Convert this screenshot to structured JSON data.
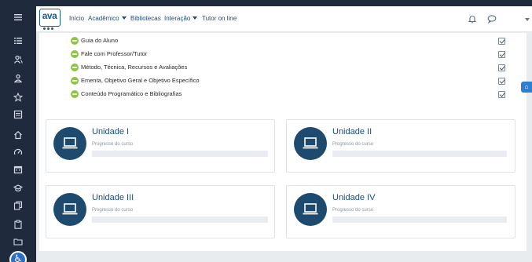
{
  "navbar": {
    "logo_text": "ava",
    "items": [
      {
        "label": "Início",
        "has_dropdown": false
      },
      {
        "label": "Acadêmico",
        "has_dropdown": true
      },
      {
        "label": "Bibliotecas",
        "has_dropdown": false
      },
      {
        "label": "Interação",
        "has_dropdown": true
      },
      {
        "label": "Tutor on line",
        "has_dropdown": false
      }
    ],
    "icons": [
      "notification-bell-icon",
      "messages-chat-icon",
      "user-menu-caret-icon"
    ]
  },
  "sidebar": {
    "icons": [
      "menu-toggle-icon",
      "list-icon",
      "users-icon",
      "group-icon",
      "star-icon",
      "courses-icon",
      "home-icon",
      "dashboard-icon",
      "calendar-icon",
      "graduation-icon",
      "files-icon",
      "clipboard-icon",
      "folder-icon",
      "accessibility-icon"
    ]
  },
  "activities": [
    {
      "label": "Guia do Aluno",
      "completed": true
    },
    {
      "label": "Fale com Professor/Tutor",
      "completed": true
    },
    {
      "label": "Método, Técnica, Recursos e Avaliações",
      "completed": true
    },
    {
      "label": "Ementa, Objetivo Geral e Objetivo Específico",
      "completed": true
    },
    {
      "label": "Conteúdo Programático e Bibliografias",
      "completed": true
    }
  ],
  "units": [
    {
      "title": "Unidade I",
      "progress_label": "Progresso do curso",
      "progress": 0
    },
    {
      "title": "Unidade II",
      "progress_label": "Progresso do curso",
      "progress": 0
    },
    {
      "title": "Unidade III",
      "progress_label": "Progresso do curso",
      "progress": 0
    },
    {
      "title": "Unidade IV",
      "progress_label": "Progresso do curso",
      "progress": 0
    }
  ],
  "colors": {
    "sidebar_bg": "#1f2a3d",
    "brand_blue": "#1e4d7a",
    "unit_circle": "#1e4a6e",
    "activity_icon": "#8dc63f",
    "accent_button": "#2d7fd0"
  }
}
